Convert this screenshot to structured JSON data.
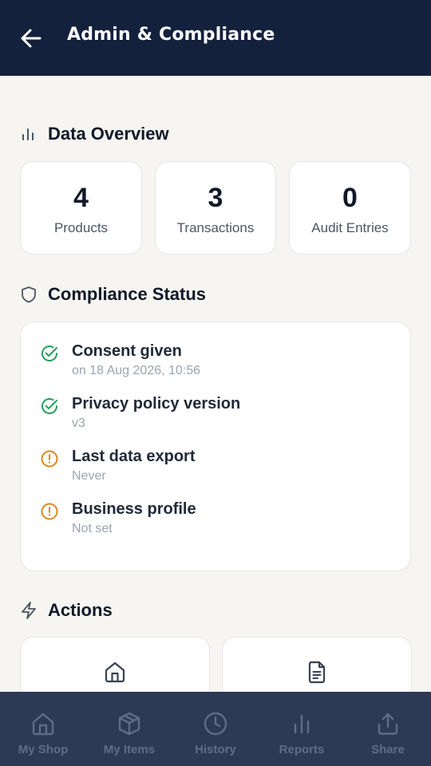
{
  "appbar": {
    "title": "Admin & Compliance",
    "back_icon": "arrow-left-icon"
  },
  "data_overview": {
    "title": "Data Overview",
    "icon": "bar-chart-icon",
    "stats": [
      {
        "value": "4",
        "label": "Products"
      },
      {
        "value": "3",
        "label": "Transactions"
      },
      {
        "value": "0",
        "label": "Audit Entries"
      }
    ]
  },
  "compliance": {
    "title": "Compliance Status",
    "icon": "shield-icon",
    "items": [
      {
        "title": "Consent given",
        "subtitle": "on 18 Aug 2026, 10:56",
        "status": "ok",
        "icon": "check-circle-icon"
      },
      {
        "title": "Privacy policy version",
        "subtitle": "v3",
        "status": "ok",
        "icon": "check-circle-icon"
      },
      {
        "title": "Last data export",
        "subtitle": "Never",
        "status": "warning",
        "icon": "alert-circle-icon"
      },
      {
        "title": "Business profile",
        "subtitle": "Not set",
        "status": "warning",
        "icon": "alert-circle-icon"
      }
    ]
  },
  "actions": {
    "title": "Actions",
    "icon": "lightning-icon",
    "cards": [
      {
        "icon": "home-icon"
      },
      {
        "icon": "document-icon"
      }
    ]
  },
  "bottom_nav": {
    "items": [
      {
        "label": "My Shop",
        "icon": "home-icon"
      },
      {
        "label": "My Items",
        "icon": "box-icon"
      },
      {
        "label": "History",
        "icon": "clock-icon"
      },
      {
        "label": "Reports",
        "icon": "bar-chart-icon"
      },
      {
        "label": "Share",
        "icon": "share-icon"
      }
    ]
  },
  "colors": {
    "appbar_bg": "#14213d",
    "nav_bg": "#2e3a55",
    "ok": "#22a05a",
    "warning": "#d98a1c",
    "page_bg": "#f6f5f1"
  }
}
